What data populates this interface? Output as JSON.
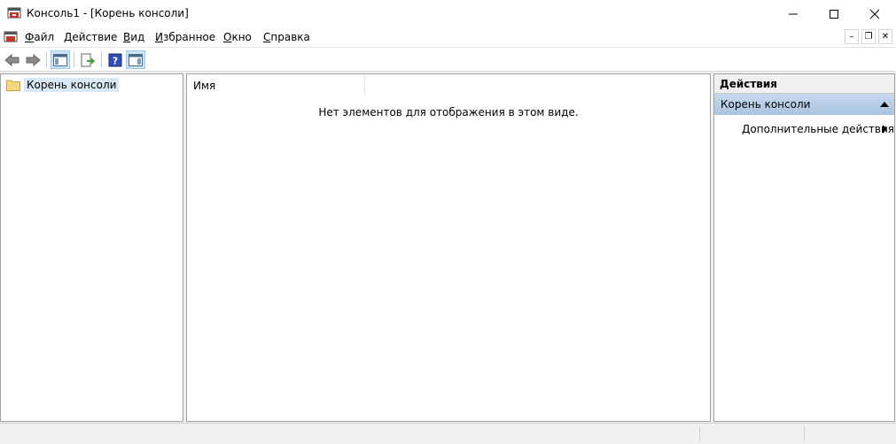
{
  "window": {
    "title": "Консоль1 - [Корень консоли]",
    "minimize_icon": "minimize-icon",
    "maximize_icon": "maximize-icon",
    "close_icon": "close-icon"
  },
  "menu": {
    "items": [
      {
        "label": "Файл",
        "access": "Ф"
      },
      {
        "label": "Действие",
        "access": "Д"
      },
      {
        "label": "Вид",
        "access": "В"
      },
      {
        "label": "Избранное",
        "access": "И"
      },
      {
        "label": "Окно",
        "access": "О"
      },
      {
        "label": "Справка",
        "access": "С"
      }
    ]
  },
  "toolbar": {
    "buttons": [
      "back-arrow-icon",
      "forward-arrow-icon",
      "show-hide-tree-icon",
      "export-list-icon",
      "help-icon",
      "show-hide-action-pane-icon"
    ]
  },
  "tree": {
    "root_label": "Корень консоли"
  },
  "list": {
    "column_name": "Имя",
    "empty_message": "Нет элементов для отображения в этом виде."
  },
  "actions": {
    "title": "Действия",
    "group_label": "Корень консоли",
    "item_label": "Дополнительные действия"
  },
  "colors": {
    "selection": "#d9e8f7",
    "action_header": "#b7cfe7",
    "border": "#a0a0a0"
  }
}
